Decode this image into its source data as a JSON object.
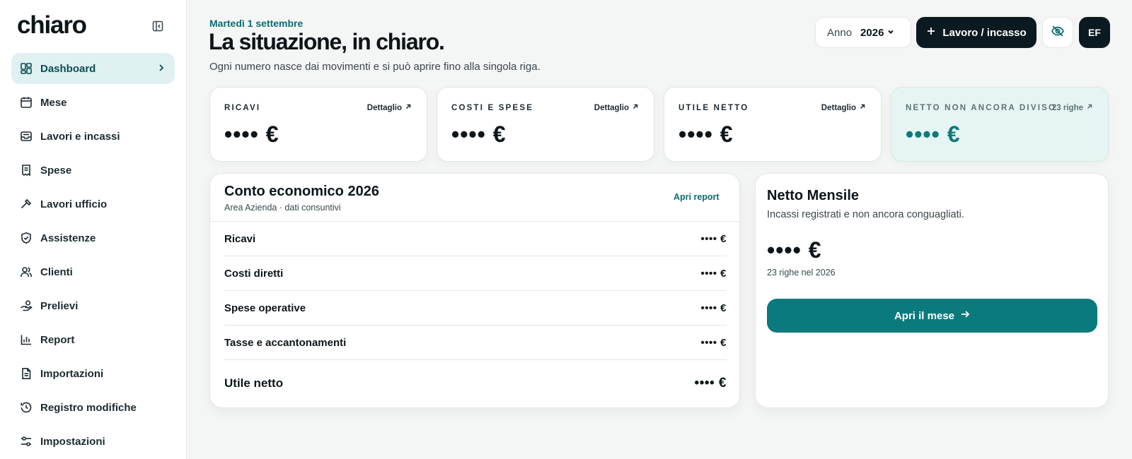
{
  "brand": {
    "logo": "chiaro"
  },
  "sidebar": {
    "items": [
      {
        "label": "Dashboard",
        "icon": "dashboard-icon"
      },
      {
        "label": "Mese",
        "icon": "calendar-icon"
      },
      {
        "label": "Lavori e incassi",
        "icon": "inbox-icon"
      },
      {
        "label": "Spese",
        "icon": "receipt-icon"
      },
      {
        "label": "Lavori ufficio",
        "icon": "hammer-icon"
      },
      {
        "label": "Assistenze",
        "icon": "shield-check-icon"
      },
      {
        "label": "Clienti",
        "icon": "users-icon"
      },
      {
        "label": "Prelievi",
        "icon": "hand-coins-icon"
      },
      {
        "label": "Report",
        "icon": "bar-chart-icon"
      },
      {
        "label": "Importazioni",
        "icon": "file-import-icon"
      },
      {
        "label": "Registro modifiche",
        "icon": "history-icon"
      },
      {
        "label": "Impostazioni",
        "icon": "sliders-icon"
      }
    ]
  },
  "header": {
    "date": "Martedì 1 settembre",
    "title": "La situazione, in chiaro.",
    "subtitle": "Ogni numero nasce dai movimenti e si può aprire fino alla singola riga.",
    "year_label": "Anno",
    "year_value": "2026",
    "add_button": "Lavoro / incasso",
    "avatar": "EF"
  },
  "kpis": [
    {
      "label": "RICAVI",
      "link": "Dettaglio",
      "value": "•••• €"
    },
    {
      "label": "COSTI E SPESE",
      "link": "Dettaglio",
      "value": "•••• €"
    },
    {
      "label": "UTILE NETTO",
      "link": "Dettaglio",
      "value": "•••• €"
    },
    {
      "label": "NETTO NON ANCORA DIVISO",
      "link": "23 righe",
      "value": "•••• €"
    }
  ],
  "income_statement": {
    "title": "Conto economico 2026",
    "subtitle": "Area Azienda · dati consuntivi",
    "link": "Apri report",
    "rows": [
      {
        "label": "Ricavi",
        "value": "•••• €"
      },
      {
        "label": "Costi diretti",
        "value": "•••• €"
      },
      {
        "label": "Spese operative",
        "value": "•••• €"
      },
      {
        "label": "Tasse e accantonamenti",
        "value": "•••• €"
      }
    ],
    "total": {
      "label": "Utile netto",
      "value": "•••• €"
    }
  },
  "monthly_net": {
    "title": "Netto Mensile",
    "subtitle": "Incassi registrati e non ancora conguagliati.",
    "value": "•••• €",
    "count": "23 righe nel 2026",
    "button": "Apri il mese"
  },
  "colors": {
    "accent": "#0a7a7d",
    "dark": "#0b1a20",
    "active_bg": "#dff1f0",
    "teal_card": "#e6f5f3"
  }
}
